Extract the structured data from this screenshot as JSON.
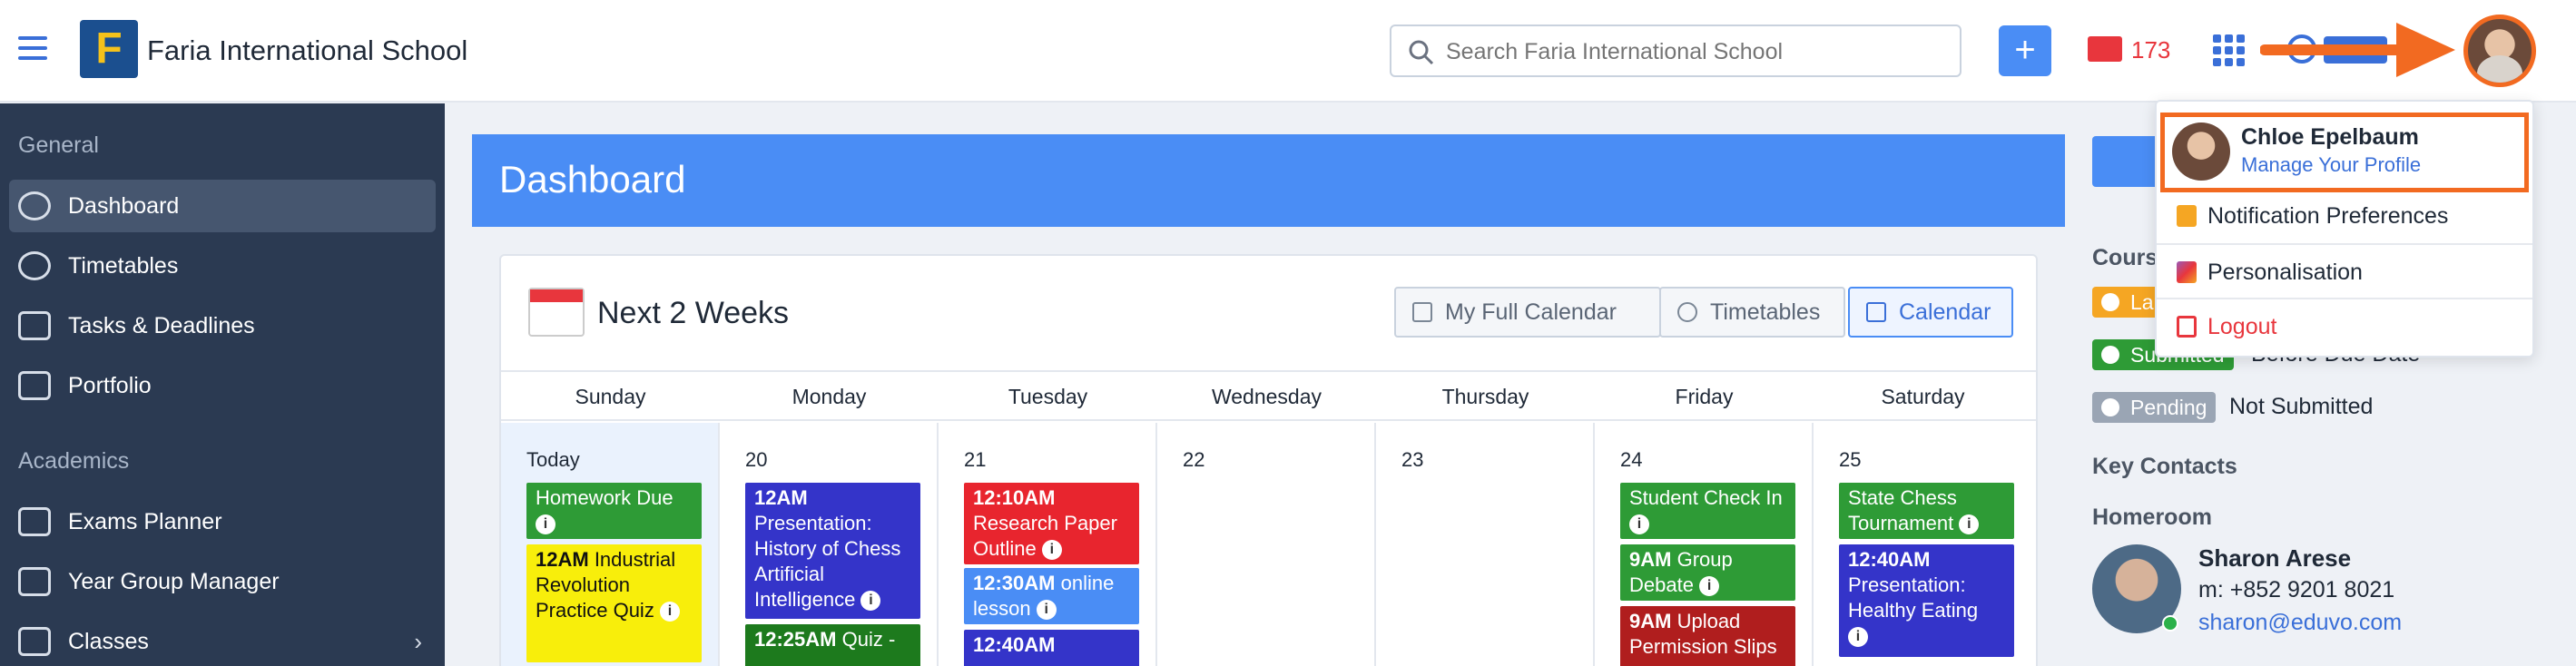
{
  "header": {
    "school_name": "Faria International School",
    "logo_letter": "F",
    "search_placeholder": "Search Faria International School",
    "add_label": "+",
    "mail_count": "173"
  },
  "sidebar": {
    "sections": [
      {
        "label": "General",
        "items": [
          {
            "label": "Dashboard",
            "icon": "gauge-icon",
            "active": true
          },
          {
            "label": "Timetables",
            "icon": "clock-icon"
          },
          {
            "label": "Tasks & Deadlines",
            "icon": "calendar-icon"
          },
          {
            "label": "Portfolio",
            "icon": "briefcase-icon"
          }
        ]
      },
      {
        "label": "Academics",
        "items": [
          {
            "label": "Exams Planner",
            "icon": "exams-icon"
          },
          {
            "label": "Year Group Manager",
            "icon": "group-icon"
          },
          {
            "label": "Classes",
            "icon": "classes-icon",
            "chevron": "›"
          }
        ]
      }
    ]
  },
  "dashboard": {
    "title": "Dashboard",
    "panel_title": "Next 2 Weeks",
    "buttons": {
      "full_calendar": "My Full Calendar",
      "timetables": "Timetables",
      "calendar": "Calendar"
    },
    "days": [
      "Sunday",
      "Monday",
      "Tuesday",
      "Wednesday",
      "Thursday",
      "Friday",
      "Saturday"
    ],
    "dates": [
      "Today",
      "20",
      "21",
      "22",
      "23",
      "24",
      "25"
    ],
    "events": {
      "sun": [
        {
          "time": "",
          "title": "Homework Due",
          "color": "#2e9b36",
          "info": true
        },
        {
          "time": "12AM",
          "title": "Industrial Revolution Practice Quiz",
          "color": "#f8ee0b",
          "info": true
        }
      ],
      "mon": [
        {
          "time": "12AM",
          "title": "Presentation: History of Chess Artificial Intelligence",
          "color": "#3434c9",
          "info": true
        },
        {
          "time": "12:25AM",
          "title": "Quiz -",
          "color": "#1d7a1d",
          "info": false
        }
      ],
      "tue": [
        {
          "time": "12:10AM",
          "title": "Research Paper Outline",
          "color": "#e8252e",
          "info": true
        },
        {
          "time": "12:30AM",
          "title": "online lesson",
          "color": "#4a8df5",
          "info": true
        },
        {
          "time": "12:40AM",
          "title": "",
          "color": "#3434c9",
          "info": false
        }
      ],
      "fri": [
        {
          "time": "",
          "title": "Student Check In",
          "color": "#2e9b36",
          "info": true
        },
        {
          "time": "9AM",
          "title": "Group Debate",
          "color": "#2e9b36",
          "info": true
        },
        {
          "time": "9AM",
          "title": "Upload Permission Slips",
          "color": "#b01e1e",
          "info": false
        }
      ],
      "sat": [
        {
          "time": "",
          "title": "State Chess Tournament",
          "color": "#2e9b36",
          "info": true
        },
        {
          "time": "12:40AM",
          "title": "Presentation: Healthy Eating",
          "color": "#3434c9",
          "info": true
        }
      ]
    }
  },
  "right": {
    "courses_label": "Cours",
    "badges": [
      {
        "label": "La",
        "color": "#f5a623",
        "text": ""
      },
      {
        "label": "Submitted",
        "color": "#2e9b36",
        "text": "Before Due Date"
      },
      {
        "label": "Pending",
        "color": "#9aa5b4",
        "text": "Not Submitted"
      }
    ],
    "key_contacts": "Key Contacts",
    "homeroom": "Homeroom",
    "contact": {
      "name": "Sharon Arese",
      "phone": "m: +852 9201 8021",
      "email": "sharon@eduvo.com"
    }
  },
  "profile_menu": {
    "name": "Chloe Epelbaum",
    "manage": "Manage Your Profile",
    "items": [
      {
        "label": "Notification Preferences",
        "icon": "bell-icon",
        "color": "#f5a623"
      },
      {
        "label": "Personalisation",
        "icon": "palette-icon",
        "color": "#9b59b6"
      },
      {
        "label": "Logout",
        "icon": "logout-icon",
        "color": "#e8363d"
      }
    ]
  },
  "colors": {
    "accent": "#4a8df5",
    "sidebar": "#2b3a52",
    "highlight": "#f26a21"
  }
}
